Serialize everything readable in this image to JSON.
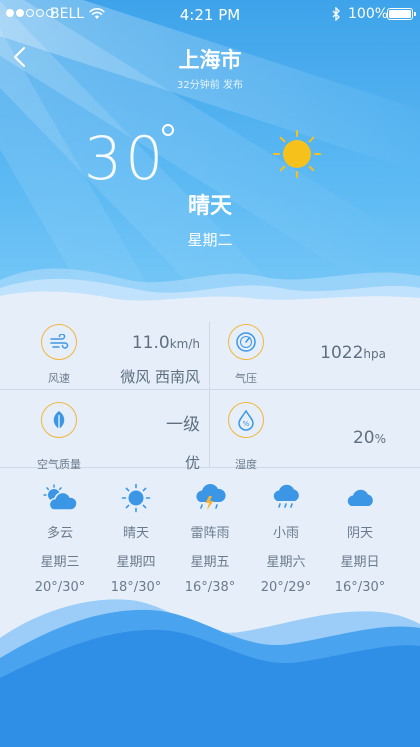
{
  "status_bar": {
    "carrier": "BELL",
    "time": "4:21 PM",
    "battery": "100%"
  },
  "header": {
    "city": "上海市",
    "published": "32分钟前 发布"
  },
  "current": {
    "temperature": "30",
    "condition": "晴天",
    "weekday": "星期二"
  },
  "details": {
    "wind": {
      "label": "风速",
      "value": "11.0",
      "unit": "km/h",
      "desc": "微风 西南风"
    },
    "pressure": {
      "label": "气压",
      "value": "1022",
      "unit": "hpa"
    },
    "air_quality": {
      "label": "空气质量",
      "value": "一级",
      "desc": "优"
    },
    "humidity": {
      "label": "湿度",
      "value": "20",
      "unit": "%"
    }
  },
  "forecast": [
    {
      "condition": "多云",
      "weekday": "星期三",
      "range": "20°/30°",
      "icon": "partly-cloudy-icon"
    },
    {
      "condition": "晴天",
      "weekday": "星期四",
      "range": "18°/30°",
      "icon": "sun-icon"
    },
    {
      "condition": "雷阵雨",
      "weekday": "星期五",
      "range": "16°/38°",
      "icon": "thunderstorm-icon"
    },
    {
      "condition": "小雨",
      "weekday": "星期六",
      "range": "20°/29°",
      "icon": "light-rain-icon"
    },
    {
      "condition": "阴天",
      "weekday": "星期日",
      "range": "16°/30°",
      "icon": "cloud-icon"
    }
  ],
  "colors": {
    "sky_top": "#3ea3ea",
    "sky_bottom": "#7ccbf8",
    "accent_icon": "#f2b53a",
    "forecast_icon": "#3b97e6",
    "text_muted": "#6a7a8c",
    "bottom_wave": "#2f8fe6"
  }
}
